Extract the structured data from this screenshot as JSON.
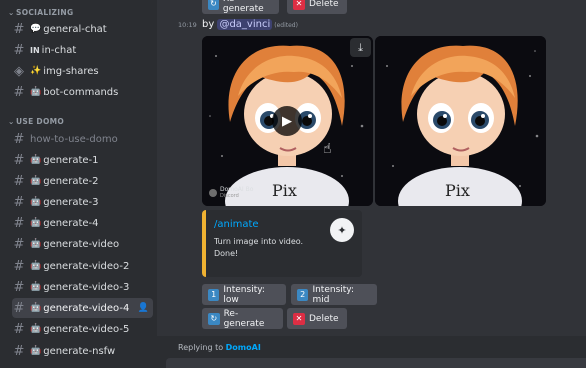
{
  "sidebar": {
    "category_socializing": "SOCIALIZING",
    "category_use_domo": "USE DOMO",
    "channels_social": [
      {
        "emoji": "💬",
        "label": "general-chat"
      },
      {
        "emoji": "IN",
        "label": "in-chat"
      },
      {
        "emoji": "✨",
        "label": "img-shares"
      },
      {
        "emoji": "🤖",
        "label": "bot-commands"
      }
    ],
    "channels_domo": [
      {
        "emoji": "",
        "label": "how-to-use-domo"
      },
      {
        "emoji": "🤖",
        "label": "generate-1"
      },
      {
        "emoji": "🤖",
        "label": "generate-2"
      },
      {
        "emoji": "🤖",
        "label": "generate-3"
      },
      {
        "emoji": "🤖",
        "label": "generate-4"
      },
      {
        "emoji": "🤖",
        "label": "generate-video"
      },
      {
        "emoji": "🤖",
        "label": "generate-video-2"
      },
      {
        "emoji": "🤖",
        "label": "generate-video-3"
      },
      {
        "emoji": "🤖",
        "label": "generate-video-4"
      },
      {
        "emoji": "🤖",
        "label": "generate-video-5"
      },
      {
        "emoji": "🤖",
        "label": "generate-nsfw"
      }
    ]
  },
  "top_buttons": {
    "regenerate": "Re-generate",
    "delete": "Delete"
  },
  "message": {
    "timestamp": "10:19",
    "by": "by",
    "author": "@da_vinci",
    "edited": "(edited)",
    "watermark_name": "DomoAI Bo",
    "watermark_sub": "Discord",
    "image_text": "Pix"
  },
  "embed": {
    "title": "/animate",
    "line1": "Turn image into video.",
    "line2": "Done!"
  },
  "buttons": {
    "intensity_low_num": "1",
    "intensity_low": "Intensity: low",
    "intensity_mid_num": "2",
    "intensity_mid": "Intensity: mid",
    "regenerate": "Re-generate",
    "delete": "Delete"
  },
  "reply": {
    "prefix": "Replying to",
    "name": "DomoAI"
  },
  "colors": {
    "accent_link": "#00a8fc",
    "embed_bar": "#f0b232",
    "sidebar_bg": "#2b2d31",
    "main_bg": "#313338"
  }
}
